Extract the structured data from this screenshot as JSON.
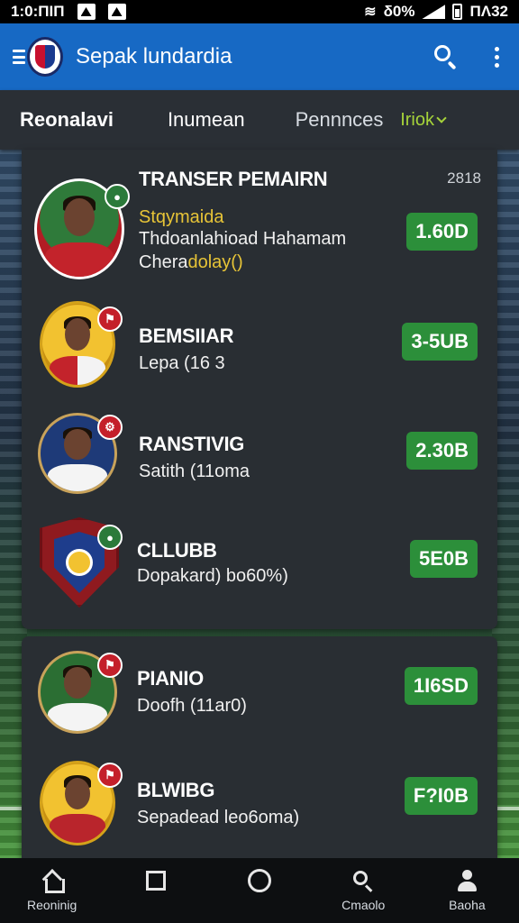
{
  "status_bar": {
    "time": "1:0:ΠΙΠ",
    "battery": "δ0%",
    "right_text": "ΠΛ32"
  },
  "app_bar": {
    "title": "Sepak lundardia",
    "icons": [
      "menu-icon",
      "club-logo",
      "search-icon",
      "more-vert-icon"
    ]
  },
  "tabs": [
    {
      "label": "Reonalavi"
    },
    {
      "label": "Inumean"
    },
    {
      "label": "Pennnces"
    },
    {
      "label": "Iriok"
    }
  ],
  "card1": {
    "header_title": "TRANSER PEMAIRN",
    "year": "2818",
    "rows": [
      {
        "line1": "Stqymaida",
        "line2": "Thdoanlahioad Hahamam",
        "line3": "Chera",
        "line3_tail": "dolay()",
        "price": "1.60D"
      },
      {
        "name": "BEMSIIAR",
        "sub": "Lepa (16 3",
        "price": "3-5UB"
      },
      {
        "name": "RANSTIVIG",
        "sub": "Satith (11oma",
        "price": "2.30B"
      },
      {
        "name": "CLLUBB",
        "sub": "Dopakard) bo60%)",
        "price": "5E0B"
      }
    ]
  },
  "card2": {
    "rows": [
      {
        "name": "PIANIO",
        "sub": "Doofh (11ar0)",
        "price": "1I6SD"
      },
      {
        "name": "BLWIBG",
        "sub": "Sepadead leo6oma)",
        "price": "F?I0B"
      }
    ]
  },
  "bottom_nav": [
    {
      "label": "Reoninig",
      "icon": "home-icon"
    },
    {
      "label": "",
      "icon": "square-icon"
    },
    {
      "label": "",
      "icon": "circle-icon"
    },
    {
      "label": "Cmaolo",
      "icon": "search-icon"
    },
    {
      "label": "Baoha",
      "icon": "person-icon"
    }
  ],
  "colors": {
    "app_bar": "#1769c4",
    "price_badge": "#2c8f3a",
    "accent_tab": "#a6d33a",
    "card": "#292e33"
  }
}
